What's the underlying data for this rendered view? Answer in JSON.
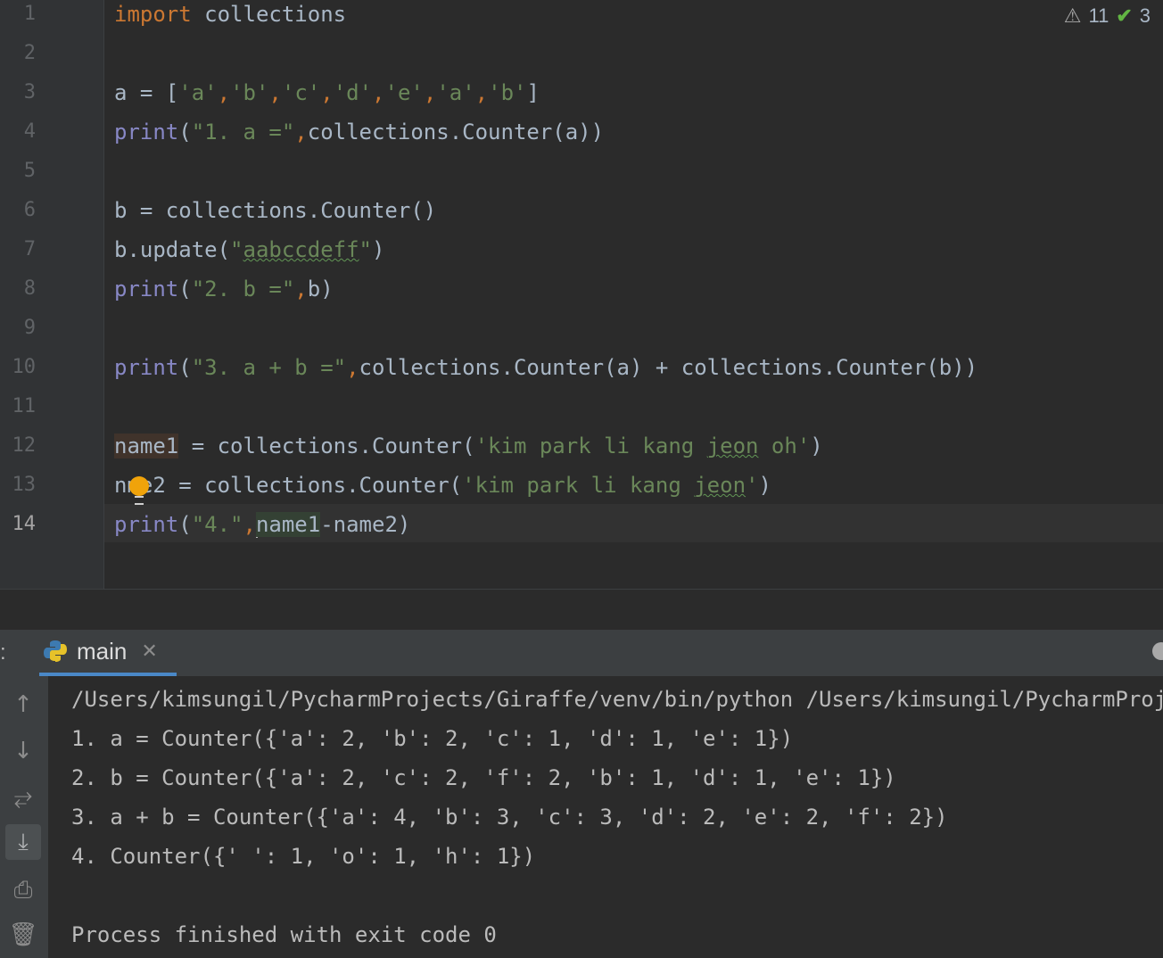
{
  "editor": {
    "line_numbers": [
      "1",
      "2",
      "3",
      "4",
      "5",
      "6",
      "7",
      "8",
      "9",
      "10",
      "11",
      "12",
      "13",
      "14"
    ],
    "current_line": "14",
    "inspections": {
      "warnings": "11",
      "weak_warnings": "3"
    },
    "code": {
      "l1_kw": "import",
      "l1_rest": " collections",
      "l3_a": "a = [",
      "l3_items": [
        "'a'",
        "'b'",
        "'c'",
        "'d'",
        "'e'",
        "'a'",
        "'b'"
      ],
      "l3_close": "]",
      "l4_fn": "print",
      "l4_open": "(",
      "l4_str": "\"1. a =\"",
      "l4_rest": "collections.Counter(a))",
      "l6": "b = collections.Counter()",
      "l7_a": "b.update(",
      "l7_q1": "\"",
      "l7_str": "aabccdeff",
      "l7_q2": "\"",
      "l7_close": ")",
      "l8_fn": "print",
      "l8_open": "(",
      "l8_str": "\"2. b =\"",
      "l8_rest": "b)",
      "l10_fn": "print",
      "l10_open": "(",
      "l10_str": "\"3. a + b =\"",
      "l10_rest": "collections.Counter(a) + collections.Counter(b))",
      "l12_name": "name1",
      "l12_mid": " = collections.Counter(",
      "l12_str_a": "'kim park li kang ",
      "l12_str_typo": "jeon",
      "l12_str_b": " oh'",
      "l12_close": ")",
      "l13_n": "n",
      "l13_rest": "me2 = collections.Counter(",
      "l13_str_a": "'kim park li kang ",
      "l13_str_typo": "jeon",
      "l13_str_b": "'",
      "l13_close": ")",
      "l14_fn": "print",
      "l14_open": "(",
      "l14_str": "\"4.\"",
      "l14_name": "name1",
      "l14_rest": "-name2)",
      "comma": ","
    }
  },
  "run": {
    "colon": ":",
    "tab_label": "main",
    "output": [
      "/Users/kimsungil/PycharmProjects/Giraffe/venv/bin/python /Users/kimsungil/PycharmProjects/Giraffe/main.py",
      "1. a = Counter({'a': 2, 'b': 2, 'c': 1, 'd': 1, 'e': 1})",
      "2. b = Counter({'a': 2, 'c': 2, 'f': 2, 'b': 1, 'd': 1, 'e': 1})",
      "3. a + b = Counter({'a': 4, 'b': 3, 'c': 3, 'd': 2, 'e': 2, 'f': 2})",
      "4. Counter({' ': 1, 'o': 1, 'h': 1})",
      "",
      "Process finished with exit code 0"
    ],
    "toolbar_icons": [
      "up-arrow-icon",
      "down-arrow-icon",
      "soft-wrap-icon",
      "scroll-to-end-icon",
      "print-icon",
      "trash-icon"
    ]
  },
  "colors": {
    "keyword": "#cc7832",
    "builtin": "#8888c6",
    "string": "#6a8759",
    "text": "#a9b7c6",
    "background": "#2b2b2b"
  }
}
